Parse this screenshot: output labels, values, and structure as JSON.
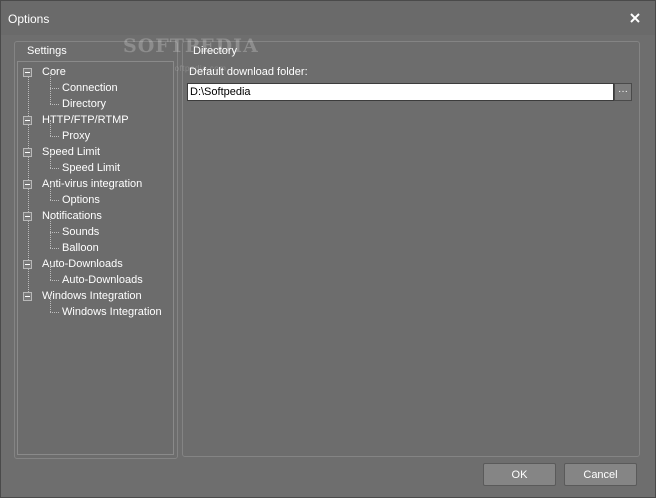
{
  "window": {
    "title": "Options"
  },
  "watermark": {
    "text": "SOFTPEDIA",
    "sub": "www.softpedia.com"
  },
  "settings": {
    "group_label": "Settings",
    "tree": [
      {
        "label": "Core",
        "level": 0
      },
      {
        "label": "Connection",
        "level": 1
      },
      {
        "label": "Directory",
        "level": 1
      },
      {
        "label": "HTTP/FTP/RTMP",
        "level": 0
      },
      {
        "label": "Proxy",
        "level": 1
      },
      {
        "label": "Speed Limit",
        "level": 0
      },
      {
        "label": "Speed Limit",
        "level": 1
      },
      {
        "label": "Anti-virus integration",
        "level": 0
      },
      {
        "label": "Options",
        "level": 1
      },
      {
        "label": "Notifications",
        "level": 0
      },
      {
        "label": "Sounds",
        "level": 1
      },
      {
        "label": "Balloon",
        "level": 1
      },
      {
        "label": "Auto-Downloads",
        "level": 0
      },
      {
        "label": "Auto-Downloads",
        "level": 1
      },
      {
        "label": "Windows Integration",
        "level": 0
      },
      {
        "label": "Windows Integration",
        "level": 1
      }
    ]
  },
  "directory": {
    "group_label": "Directory",
    "field_label": "Default download folder:",
    "path_value": "D:\\Softpedia",
    "browse_label": "···"
  },
  "buttons": {
    "ok": "OK",
    "cancel": "Cancel"
  },
  "icons": {
    "close": "close-icon",
    "expander": "minus-box-icon"
  }
}
